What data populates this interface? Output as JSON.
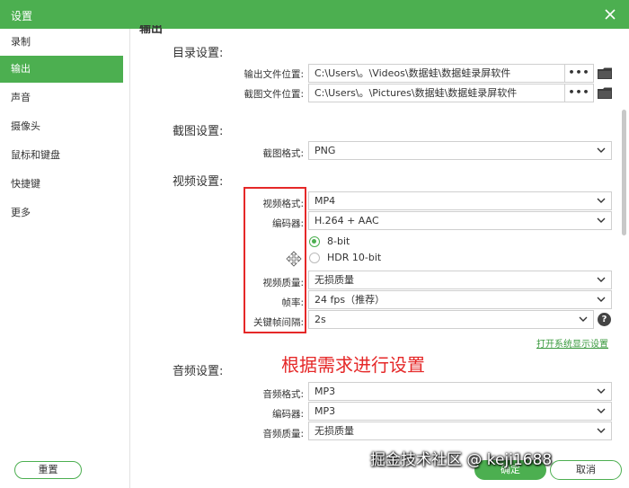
{
  "window": {
    "title": "设置"
  },
  "sidebar": {
    "items": [
      {
        "label": "录制"
      },
      {
        "label": "输出"
      },
      {
        "label": "声音"
      },
      {
        "label": "摄像头"
      },
      {
        "label": "鼠标和键盘"
      },
      {
        "label": "快捷键"
      },
      {
        "label": "更多"
      }
    ],
    "active_index": 1,
    "reset_label": "重置"
  },
  "main": {
    "header": "输出",
    "directory": {
      "title": "目录设置:",
      "output_label": "输出文件位置:",
      "output_value": "C:\\Users\\。\\Videos\\数据蛙\\数据蛙录屏软件",
      "screenshot_label": "截图文件位置:",
      "screenshot_value": "C:\\Users\\。\\Pictures\\数据蛙\\数据蛙录屏软件",
      "browse_label": "•••"
    },
    "screenshot": {
      "title": "截图设置:",
      "format_label": "截图格式:",
      "format_value": "PNG"
    },
    "video": {
      "title": "视频设置:",
      "format_label": "视频格式:",
      "format_value": "MP4",
      "encoder_label": "编码器:",
      "encoder_value": "H.264 + AAC",
      "bitdepth_options": [
        "8-bit",
        "HDR 10-bit"
      ],
      "bitdepth_selected": "8-bit",
      "quality_label": "视频质量:",
      "quality_value": "无损质量",
      "fps_label": "帧率:",
      "fps_value": "24 fps（推荐）",
      "keyframe_label": "关键帧间隔:",
      "keyframe_value": "2s",
      "help_glyph": "?",
      "display_link": "打开系统显示设置"
    },
    "audio": {
      "title": "音频设置:",
      "format_label": "音频格式:",
      "format_value": "MP3",
      "encoder_label": "编码器:",
      "encoder_value": "MP3",
      "quality_label": "音频质量:",
      "quality_value": "无损质量"
    }
  },
  "annotation": {
    "text": "根据需求进行设置"
  },
  "footer": {
    "ok_label": "确定",
    "cancel_label": "取消"
  },
  "watermark": {
    "text": "掘金技术社区 @ keji1688"
  },
  "colors": {
    "accent": "#4caf50",
    "annotation": "#e52828"
  }
}
